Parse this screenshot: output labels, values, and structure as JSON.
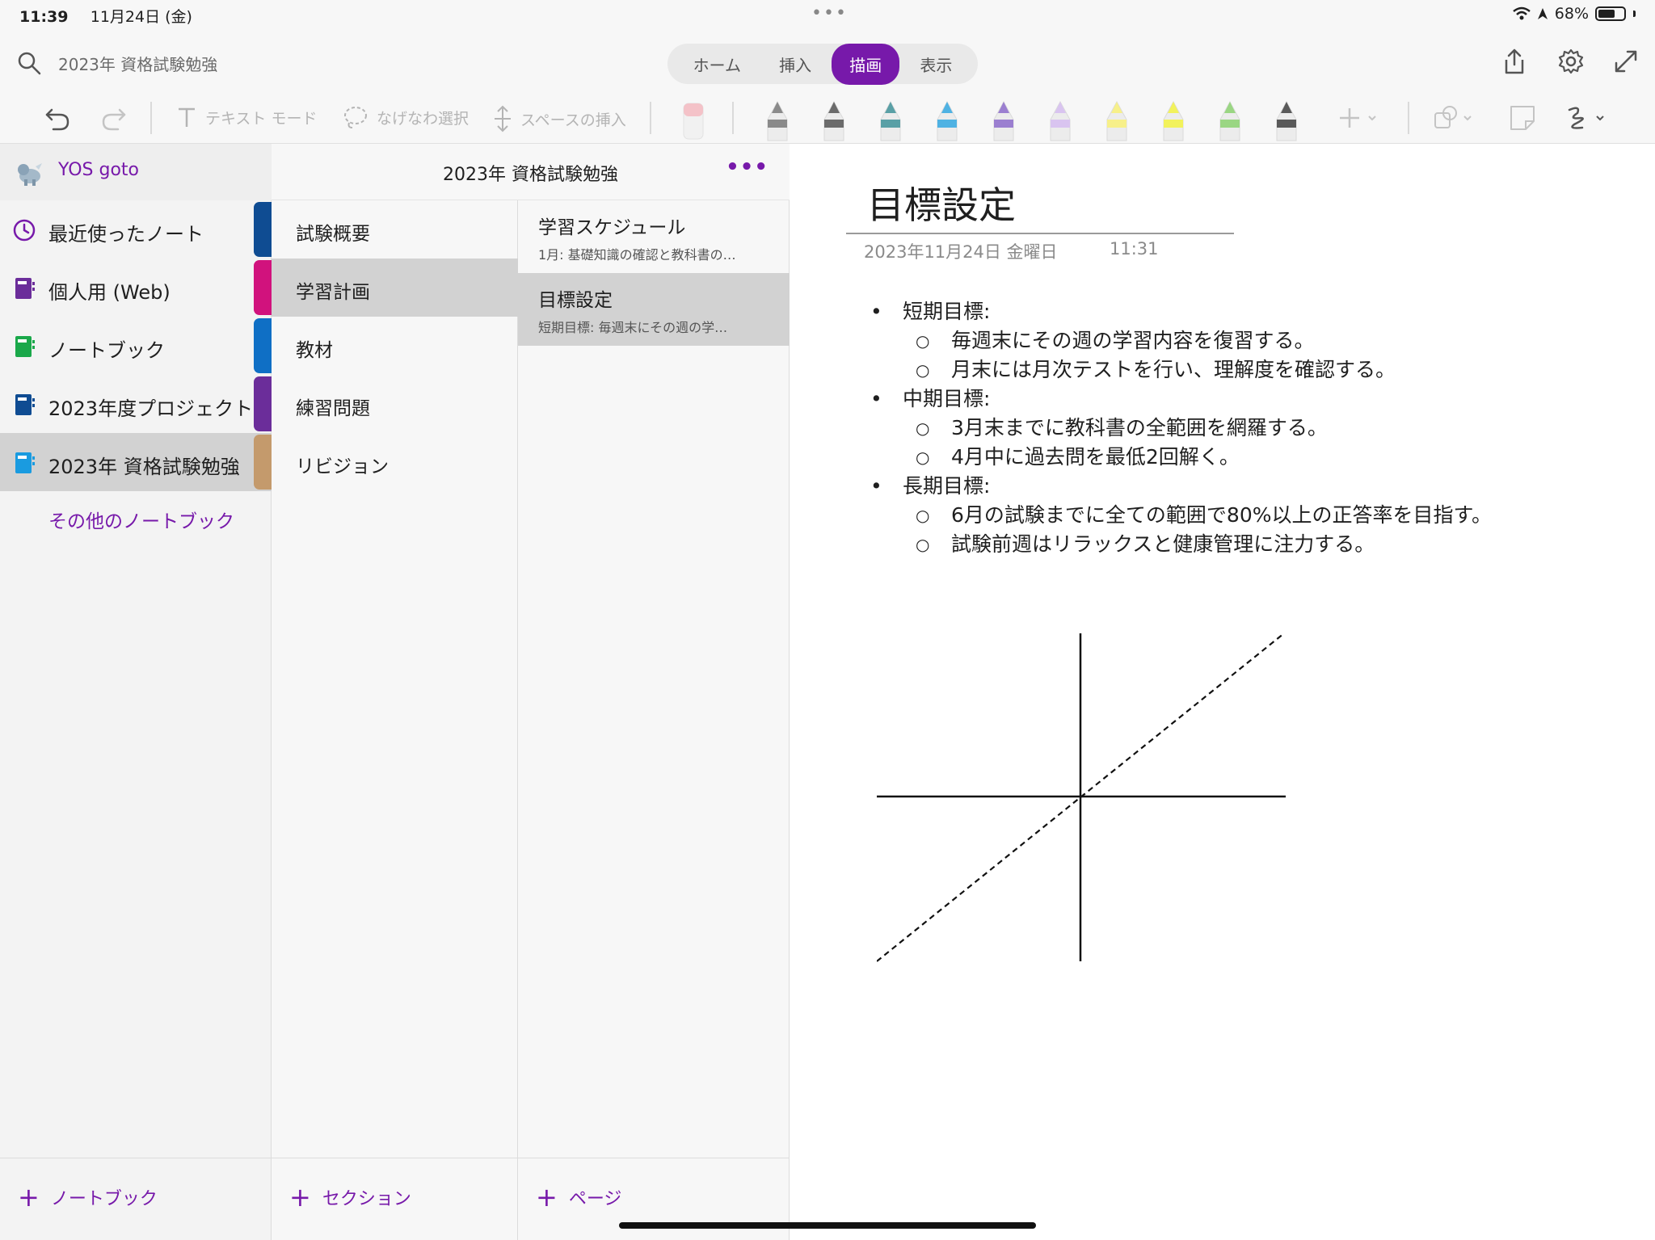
{
  "status_bar": {
    "time": "11:39",
    "date": "11月24日 (金)",
    "battery": "68%",
    "battery_level": 0.68
  },
  "topbar": {
    "search_text": "2023年 資格試験勉強",
    "tabs": [
      {
        "label": "ホーム",
        "active": false
      },
      {
        "label": "挿入",
        "active": false
      },
      {
        "label": "描画",
        "active": true
      },
      {
        "label": "表示",
        "active": false
      }
    ],
    "accent_color": "#7719aa",
    "icons": [
      "share-icon",
      "settings-gear-icon",
      "expand-icon"
    ]
  },
  "toolbar": {
    "text_mode": "テキスト モード",
    "lasso_select": "なげなわ選択",
    "insert_space": "スペースの挿入",
    "pen_colors": [
      "#8a8a8a",
      "#6b6b6b",
      "#5aa0a6",
      "#4fb2e3",
      "#9b7fd0",
      "#d9c4f0",
      "#f7f08a",
      "#f2f25c",
      "#9ad683",
      "#5a5a5a"
    ]
  },
  "notebooks": {
    "user": "YOS goto",
    "items": [
      {
        "label": "最近使ったノート",
        "icon": "clock-icon",
        "color": "#7719aa",
        "tab_color": "#0f4c92",
        "selected": false
      },
      {
        "label": "個人用 (Web)",
        "icon": "notebook-icon",
        "color": "#6b2d9a",
        "tab_color": "#d1127d",
        "selected": false
      },
      {
        "label": "ノートブック",
        "icon": "notebook-icon",
        "color": "#1aa84a",
        "tab_color": "#0f6fc5",
        "selected": false
      },
      {
        "label": "2023年度プロジェクト",
        "icon": "notebook-icon",
        "color": "#0f4c92",
        "tab_color": "#6b2d9a",
        "selected": false
      },
      {
        "label": "2023年 資格試験勉強",
        "icon": "notebook-icon",
        "color": "#1a9be0",
        "tab_color": "#c49a6c",
        "selected": true
      }
    ],
    "more": "その他のノートブック",
    "add_label": "ノートブック"
  },
  "sections": {
    "notebook_title": "2023年 資格試験勉強",
    "items": [
      {
        "label": "試験概要",
        "selected": false
      },
      {
        "label": "学習計画",
        "selected": true
      },
      {
        "label": "教材",
        "selected": false
      },
      {
        "label": "練習問題",
        "selected": false
      },
      {
        "label": "リビジョン",
        "selected": false
      }
    ],
    "add_label": "セクション"
  },
  "pages": {
    "items": [
      {
        "title": "学習スケジュール",
        "snippet": "1月: 基礎知識の確認と教科書の…",
        "selected": false
      },
      {
        "title": "目標設定",
        "snippet": "短期目標:  毎週末にその週の学…",
        "selected": true
      }
    ],
    "add_label": "ページ"
  },
  "note": {
    "title": "目標設定",
    "date": "2023年11月24日 金曜日",
    "time": "11:31",
    "goals": [
      {
        "label": "短期目標:",
        "items": [
          "毎週末にその週の学習内容を復習する。",
          "月末には月次テストを行い、理解度を確認する。"
        ]
      },
      {
        "label": "中期目標:",
        "items": [
          "3月末までに教科書の全範囲を網羅する。",
          "4月中に過去問を最低2回解く。"
        ]
      },
      {
        "label": "長期目標:",
        "items": [
          "6月の試験までに全ての範囲で80%以上の正答率を目指す。",
          "試験前週はリラックスと健康管理に注力する。"
        ]
      }
    ]
  }
}
